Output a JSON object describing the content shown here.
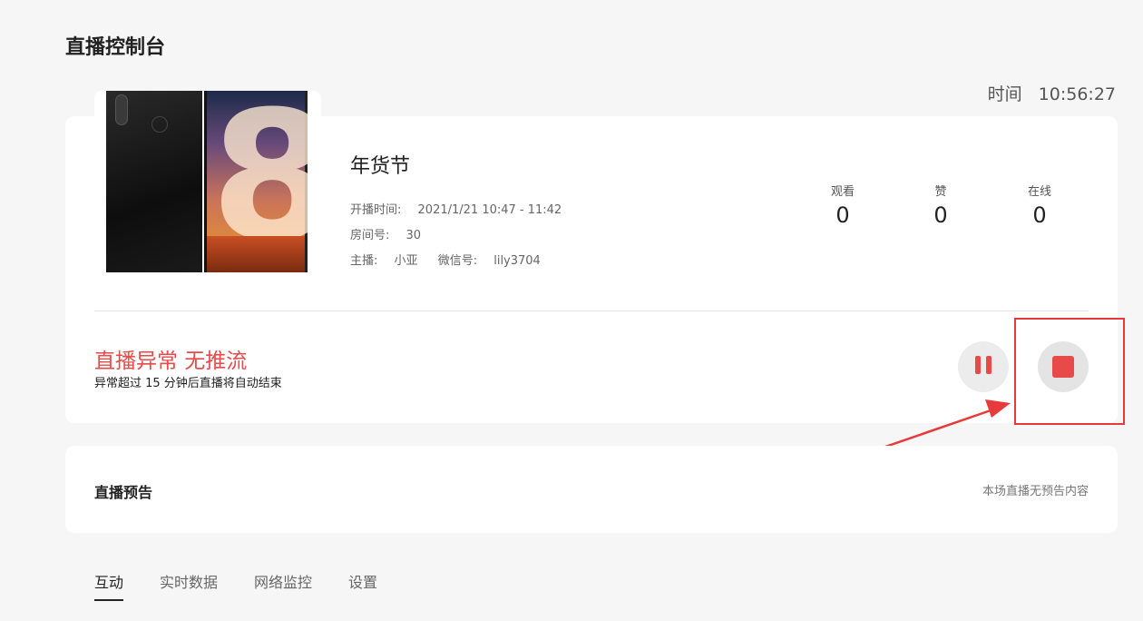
{
  "page": {
    "title": "直播控制台"
  },
  "clock": {
    "label": "时间",
    "value": "10:56:27"
  },
  "live": {
    "title": "年货节",
    "start_time_label": "开播时间:",
    "start_time_value": "2021/1/21 10:47 - 11:42",
    "room_label": "房间号:",
    "room_value": "30",
    "host_label": "主播:",
    "host_value": "小亚",
    "wechat_label": "微信号:",
    "wechat_value": "lily3704"
  },
  "stats": [
    {
      "label": "观看",
      "value": "0"
    },
    {
      "label": "赞",
      "value": "0"
    },
    {
      "label": "在线",
      "value": "0"
    }
  ],
  "status": {
    "text": "直播异常 无推流",
    "subtext": "异常超过 15 分钟后直播将自动结束",
    "color": "#e84a4a"
  },
  "controls": {
    "pause_icon": "pause-icon",
    "stop_icon": "stop-icon"
  },
  "preview": {
    "title": "直播预告",
    "empty_text": "本场直播无预告内容"
  },
  "tabs": [
    {
      "label": "互动",
      "active": true
    },
    {
      "label": "实时数据",
      "active": false
    },
    {
      "label": "网络监控",
      "active": false
    },
    {
      "label": "设置",
      "active": false
    }
  ]
}
